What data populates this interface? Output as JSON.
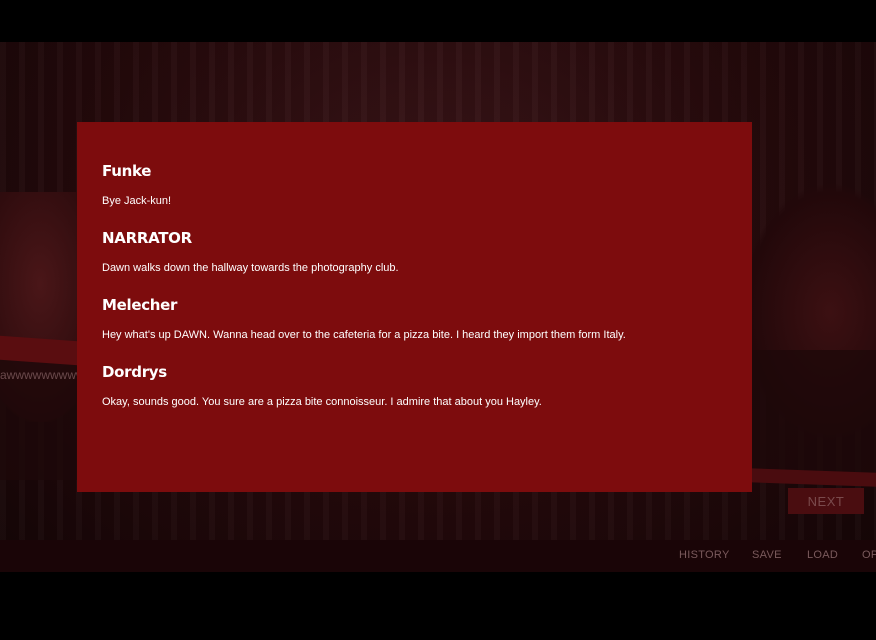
{
  "history": {
    "entries": [
      {
        "speaker": "Funke",
        "text": "Bye Jack-kun!"
      },
      {
        "speaker": "NARRATOR",
        "text": "Dawn walks down the hallway towards the photography club."
      },
      {
        "speaker": "Melecher",
        "text": "Hey what's up DAWN. Wanna head over to the cafeteria for a pizza bite. I heard they import them form Italy."
      },
      {
        "speaker": "Dordrys",
        "text": "Okay, sounds good. You sure are a pizza bite connoisseur. I admire that about you Hayley."
      }
    ]
  },
  "background": {
    "dialogue_text_fragment": "awwwwwwwwww"
  },
  "controls": {
    "next_label": "NEXT"
  },
  "menu": {
    "history": "HISTORY",
    "save": "SAVE",
    "load": "LOAD",
    "options": "OP"
  },
  "colors": {
    "modal_bg": "#7d0c0d",
    "text": "#ffffff",
    "menu_text": "#7a5a5c"
  }
}
